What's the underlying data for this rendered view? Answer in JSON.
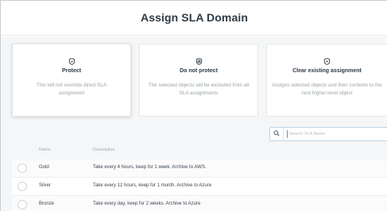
{
  "dialog": {
    "title": "Assign SLA Domain"
  },
  "options": [
    {
      "title": "Protect",
      "description": "This will not override direct SLA assignment",
      "icon": "shield-check-icon"
    },
    {
      "title": "Do not protect",
      "description": "The selected objects will be excluded from all SLA assignments",
      "icon": "shield-off-icon"
    },
    {
      "title": "Clear existing assignment",
      "description": "Assigns selected objects and their contents to the next higher level object",
      "icon": "shield-clear-icon"
    }
  ],
  "search": {
    "placeholder": "Search SLA Name",
    "value": ""
  },
  "table": {
    "columns": [
      "Name",
      "Description"
    ],
    "rows": [
      {
        "name": "Gold",
        "description": "Take every 4 hours, keep for 1 week. Archive to AWS."
      },
      {
        "name": "Silver",
        "description": "Take every 12 hours, keep for 1 month. Archive to Azure"
      },
      {
        "name": "Bronze",
        "description": "Take every day, keep for 2 weeks. Archive to Azure"
      }
    ]
  },
  "colors": {
    "accent": "#4d8fd6",
    "text": "#2d3a42",
    "muted": "#9aa3a9",
    "background": "#f5f6f7"
  }
}
